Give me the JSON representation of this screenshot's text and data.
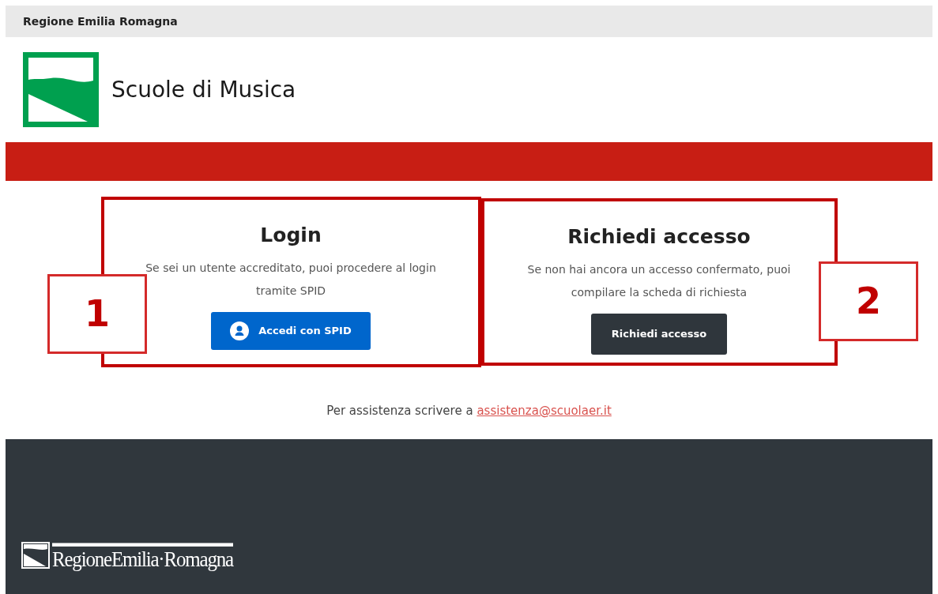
{
  "top_bar": {
    "title": "Regione Emilia Romagna"
  },
  "header": {
    "title": "Scuole di Musica"
  },
  "cards": [
    {
      "title": "Login",
      "text": "Se sei un utente accreditato, puoi procedere al login tramite SPID",
      "button": "Accedi con SPID",
      "kind": "spid",
      "callout": "1"
    },
    {
      "title": "Richiedi accesso",
      "text": "Se non hai ancora un accesso confermato, puoi compilare la scheda di richiesta",
      "button": "Richiedi accesso",
      "kind": "dark",
      "callout": "2"
    }
  ],
  "assistance": {
    "text": "Per assistenza scrivere a",
    "email": "assistenza@scuolaer.it"
  },
  "footer": {
    "logo_text": "RegioneEmilia·Romagna"
  }
}
